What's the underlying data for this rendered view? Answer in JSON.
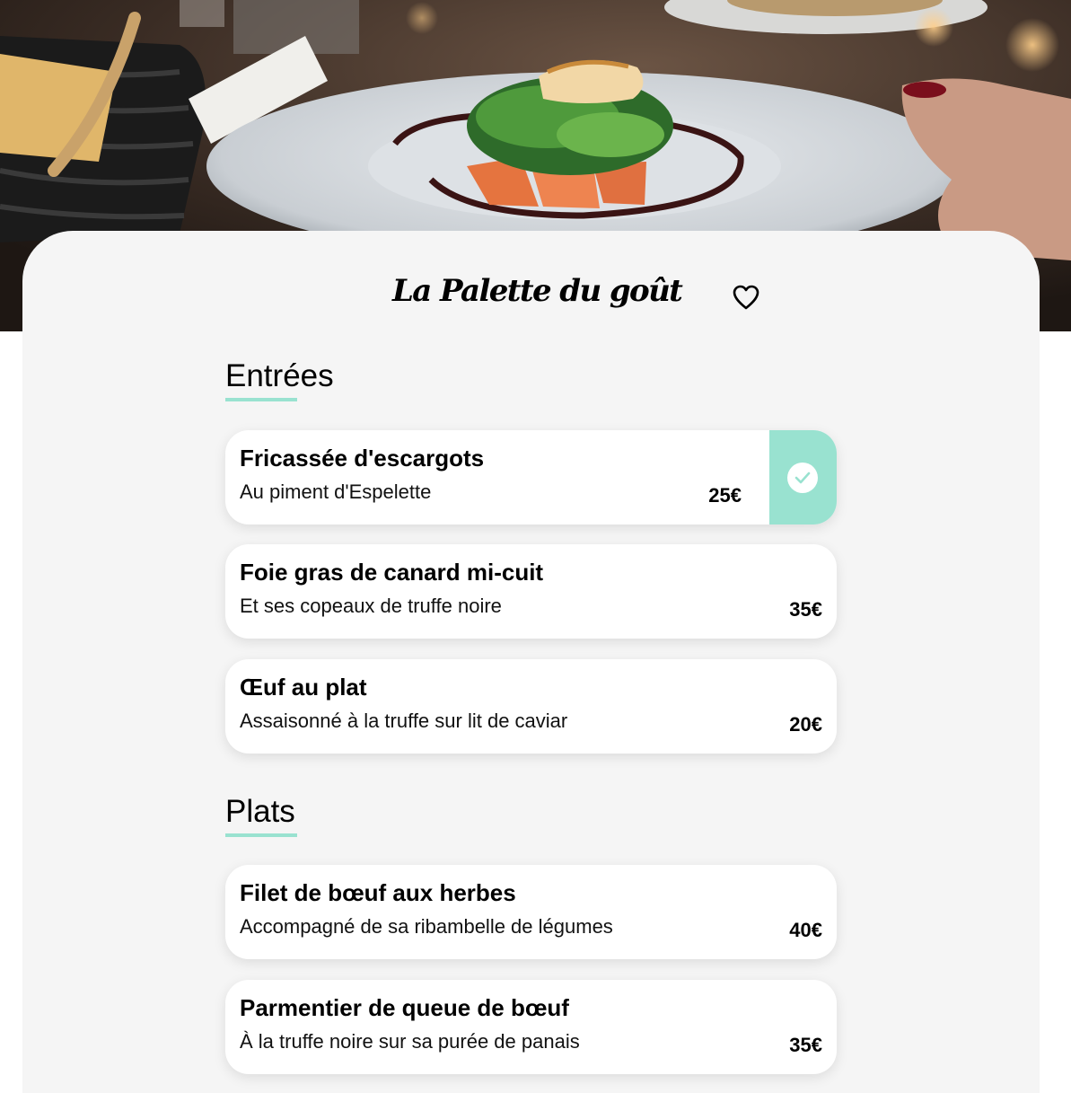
{
  "restaurant": {
    "name": "La Palette du goût"
  },
  "icons": {
    "favorite": "heart-outline-icon",
    "selected": "check-circle-icon"
  },
  "colors": {
    "accent": "#99e2d0",
    "panel_bg": "#f5f5f5",
    "card_bg": "#ffffff",
    "text": "#000000"
  },
  "menu": {
    "sections": [
      {
        "title": "Entrées",
        "items": [
          {
            "name": "Fricassée d'escargots",
            "description": "Au piment d'Espelette",
            "price": "25€",
            "selected": true
          },
          {
            "name": "Foie gras de canard mi-cuit",
            "description": "Et ses copeaux de truffe noire",
            "price": "35€",
            "selected": false
          },
          {
            "name": "Œuf au plat",
            "description": "Assaisonné à la truffe sur lit de caviar",
            "price": "20€",
            "selected": false
          }
        ]
      },
      {
        "title": "Plats",
        "items": [
          {
            "name": "Filet de bœuf aux herbes",
            "description": "Accompagné de sa ribambelle de légumes",
            "price": "40€",
            "selected": false
          },
          {
            "name": "Parmentier de queue de bœuf",
            "description": "À la truffe noire sur sa purée de panais",
            "price": "35€",
            "selected": false
          }
        ]
      }
    ]
  }
}
